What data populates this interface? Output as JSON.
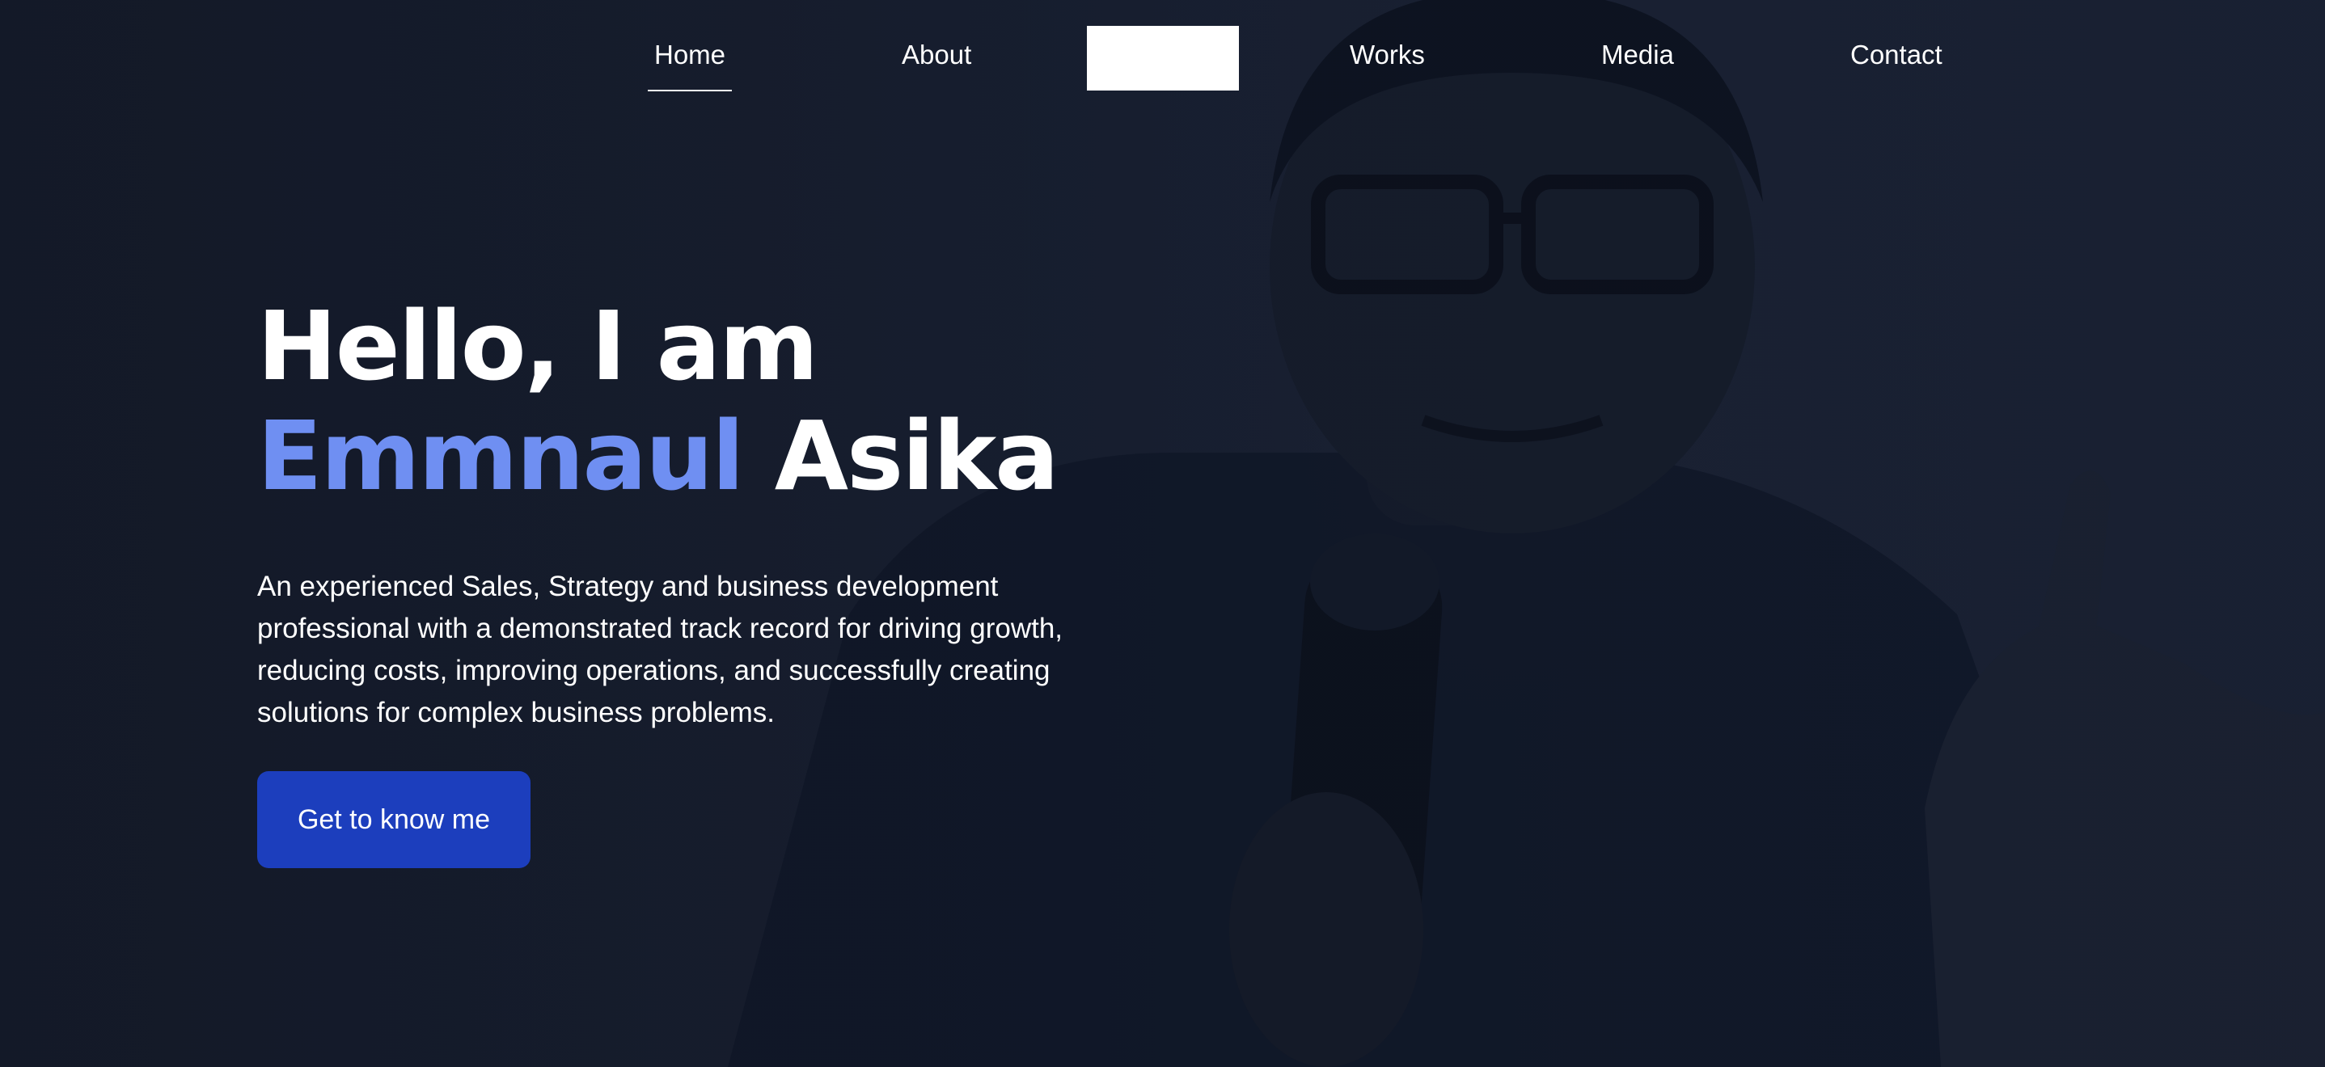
{
  "nav": {
    "items": [
      {
        "label": "Home",
        "active": true
      },
      {
        "label": "About",
        "active": false
      },
      {
        "label": "Works",
        "active": false
      },
      {
        "label": "Media",
        "active": false
      },
      {
        "label": "Contact",
        "active": false
      }
    ]
  },
  "hero": {
    "greeting": "Hello, I am",
    "first_name": "Emmnaul",
    "last_name": "Asika",
    "description": "An experienced Sales, Strategy and business development professional with a demonstrated track record for driving growth, reducing costs, improving operations, and successfully creating solutions for complex business problems.",
    "cta_label": "Get to know me"
  },
  "colors": {
    "background": "#141b2c",
    "accent_name": "#6f8ff2",
    "cta_background": "#1c3ebd",
    "text": "#ffffff"
  }
}
